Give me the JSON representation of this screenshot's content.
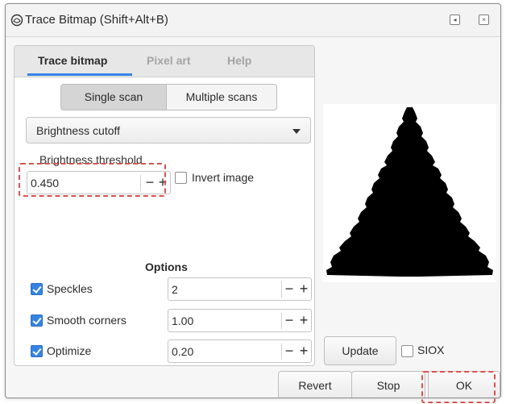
{
  "window": {
    "title": "Trace Bitmap (Shift+Alt+B)",
    "minimize_glyph": "◂",
    "close_glyph": "×"
  },
  "tabs": [
    {
      "label": "Trace bitmap",
      "active": true
    },
    {
      "label": "Pixel art",
      "active": false
    },
    {
      "label": "Help",
      "active": false
    }
  ],
  "scan_modes": {
    "single": "Single scan",
    "multiple": "Multiple scans",
    "selected": "Single scan"
  },
  "detection_mode": {
    "selected": "Brightness cutoff"
  },
  "brightness": {
    "label": "Brightness threshold",
    "value": "0.450",
    "minus": "−",
    "plus": "+"
  },
  "invert": {
    "label": "Invert image",
    "checked": false
  },
  "options": {
    "heading": "Options",
    "items": [
      {
        "label": "Speckles",
        "checked": true,
        "value": "2"
      },
      {
        "label": "Smooth corners",
        "checked": true,
        "value": "1.00"
      },
      {
        "label": "Optimize",
        "checked": true,
        "value": "0.20"
      }
    ]
  },
  "preview": {
    "update_label": "Update",
    "siox_label": "SIOX",
    "siox_checked": false
  },
  "footer": {
    "revert_label": "Revert",
    "stop_label": "Stop",
    "ok_label": "OK"
  },
  "colors": {
    "accent": "#3584e4",
    "highlight": "#d9534f"
  },
  "icons": {
    "title": "inkscape-icon",
    "dropdown": "chevron-down-icon"
  }
}
